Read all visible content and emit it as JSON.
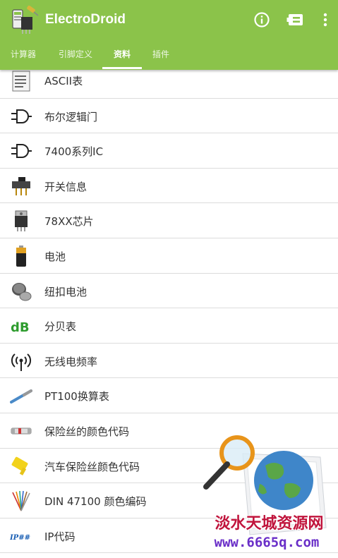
{
  "app": {
    "title": "ElectroDroid",
    "accent_color": "#8bc34a"
  },
  "appbar": {
    "icons": [
      "info-icon",
      "plug-icon",
      "overflow-menu-icon"
    ]
  },
  "tabs": [
    {
      "label": "计算器"
    },
    {
      "label": "引脚定义"
    },
    {
      "label": "资料",
      "active": true
    },
    {
      "label": "插件"
    }
  ],
  "items": [
    {
      "label": "ASCII表",
      "icon": "ascii-table-icon"
    },
    {
      "label": "布尔逻辑门",
      "icon": "logic-gate-icon"
    },
    {
      "label": "7400系列IC",
      "icon": "logic-gate-icon"
    },
    {
      "label": "开关信息",
      "icon": "switch-icon"
    },
    {
      "label": "78XX芯片",
      "icon": "voltage-regulator-icon"
    },
    {
      "label": "电池",
      "icon": "battery-icon"
    },
    {
      "label": "纽扣电池",
      "icon": "coin-cell-icon"
    },
    {
      "label": "分贝表",
      "icon": "decibel-icon"
    },
    {
      "label": "无线电频率",
      "icon": "radio-signal-icon"
    },
    {
      "label": "PT100换算表",
      "icon": "temperature-sensor-icon"
    },
    {
      "label": "保险丝的颜色代码",
      "icon": "glass-fuse-icon"
    },
    {
      "label": "汽车保险丝颜色代码",
      "icon": "blade-fuse-icon"
    },
    {
      "label": "DIN 47100 颜色编码",
      "icon": "wire-bundle-icon"
    },
    {
      "label": "IP代码",
      "icon": "ip-code-icon"
    }
  ],
  "watermark": {
    "site_name": "淡水天城资源网",
    "url": "www.6665q.com"
  }
}
